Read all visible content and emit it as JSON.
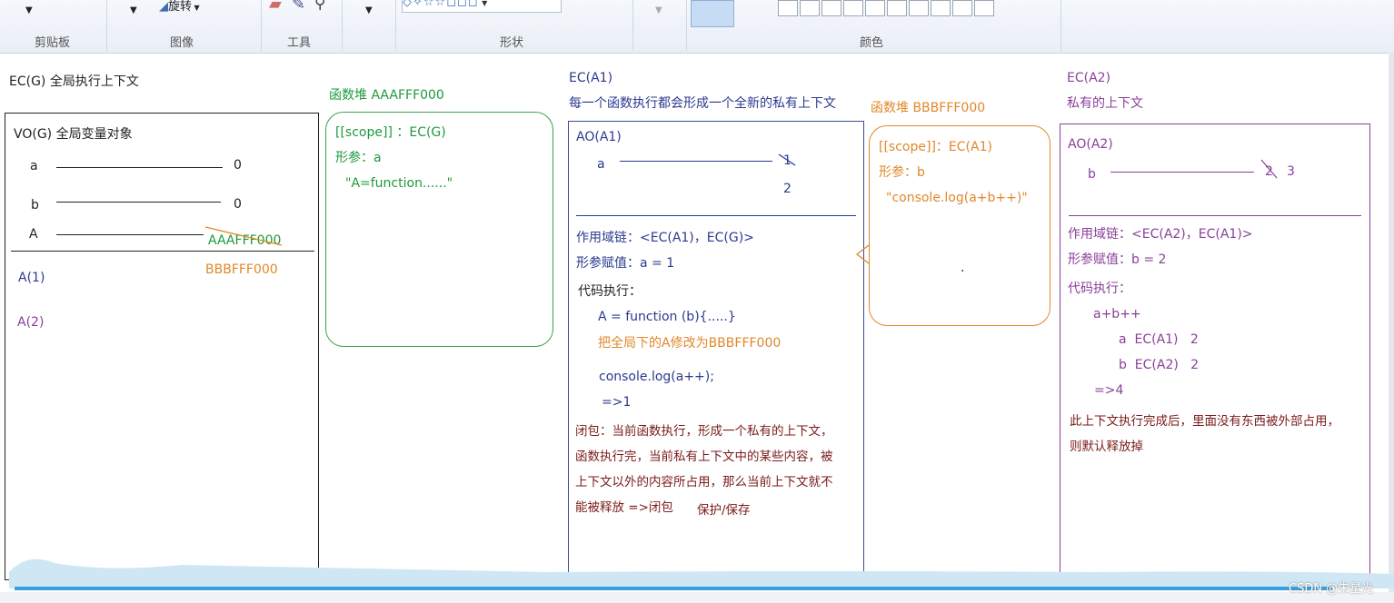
{
  "ribbon": {
    "groups": [
      {
        "label": "剪贴板"
      },
      {
        "label": "图像"
      },
      {
        "label": "工具"
      },
      {
        "label": "形状"
      },
      {
        "label": "颜色"
      }
    ],
    "rotate_label": "旋转"
  },
  "global": {
    "title": "EC(G) 全局执行上下文",
    "vo_title": "VO(G) 全局变量对象",
    "vars": [
      {
        "name": "a",
        "value": "0"
      },
      {
        "name": "b",
        "value": "0"
      },
      {
        "name": "A",
        "value": "AAAFFF000"
      }
    ],
    "a_new_value": "BBBFFF000",
    "stack": [
      "A(1)",
      "A(2)"
    ]
  },
  "heap_a": {
    "title": "函数堆  AAAFFF000",
    "lines": [
      "[[scope]] ：EC(G)",
      "形参：a",
      "\"A=function......\""
    ]
  },
  "ec_a1": {
    "title": "EC(A1)",
    "subtitle": "每一个函数执行都会形成一个全新的私有上下文",
    "ao_title": "AO(A1)",
    "var_name": "a",
    "old_value": "1",
    "new_value": "2",
    "scope_chain": "作用域链：<EC(A1)，EC(G)>",
    "param_assign": "形参赋值：a = 1",
    "code_exec": "代码执行：",
    "code1": "A = function (b){.....}",
    "code2": "把全局下的A修改为BBBFFF000",
    "code3": "console.log(a++);",
    "code4": "=>1",
    "closure_lines": [
      "闭包：当前函数执行，形成一个私有的上下文，",
      "函数执行完，当前私有上下文中的某些内容，被",
      "上下文以外的内容所占用，那么当前上下文就不",
      "能被释放  =>闭包"
    ],
    "protect": "保护/保存"
  },
  "heap_b": {
    "title": "函数堆   BBBFFF000",
    "lines": [
      "[[scope]]：EC(A1)",
      "形参：b",
      "\"console.log(a+b++)\""
    ],
    "dot": "."
  },
  "ec_a2": {
    "title": "EC(A2)",
    "subtitle": "私有的上下文",
    "ao_title": "AO(A2)",
    "var_name": "b",
    "old_value": "2",
    "new_value": "3",
    "scope_chain": "作用域链：<EC(A2)，EC(A1)>",
    "param_assign": "形参赋值：b = 2",
    "code_exec": "代码执行：",
    "expr": "a+b++",
    "line_a": "a  EC(A1)   2",
    "line_b": "b  EC(A2)   2",
    "result": "=>4",
    "note_lines": [
      "此上下文执行完成后，里面没有东西被外部占用，",
      "则默认释放掉"
    ]
  },
  "watermark": "CSDN @朱星光",
  "colors": {
    "navy": "#2b3a8f",
    "green": "#1e9a3c",
    "orange": "#e0882a",
    "purple": "#8a3f9a",
    "accent_blue": "#39a0e0"
  }
}
